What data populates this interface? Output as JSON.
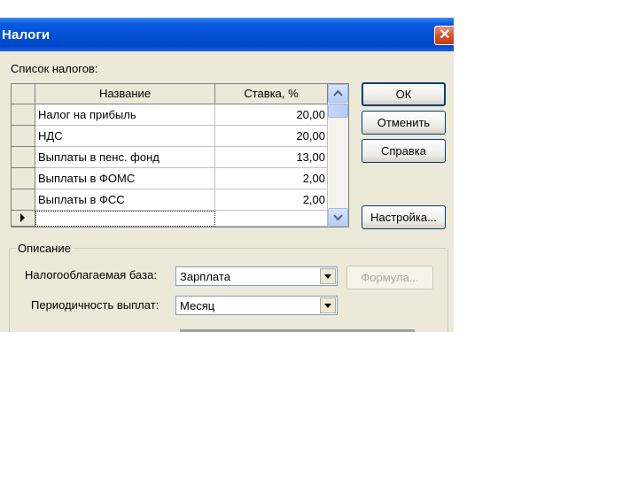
{
  "window": {
    "title": "Налоги",
    "close_glyph": "✕"
  },
  "list_label": "Список налогов:",
  "table": {
    "columns": [
      "Название",
      "Ставка, %"
    ],
    "rows": [
      {
        "name": "Налог на прибыль",
        "rate": "20,00"
      },
      {
        "name": "НДС",
        "rate": "20,00"
      },
      {
        "name": "Выплаты в пенс. фонд",
        "rate": "13,00"
      },
      {
        "name": "Выплаты в ФОМС",
        "rate": "2,00"
      },
      {
        "name": "Выплаты в ФСС",
        "rate": "2,00"
      },
      {
        "name": "",
        "rate": ""
      }
    ]
  },
  "buttons": {
    "ok": "ОК",
    "cancel": "Отменить",
    "help": "Справка",
    "settings": "Настройка...",
    "formula": "Формула..."
  },
  "description": {
    "legend": "Описание",
    "tax_base_label": "Налогооблагаемая база:",
    "tax_base_value": "Зарплата",
    "period_label": "Периодичность выплат:",
    "period_value": "Месяц"
  }
}
